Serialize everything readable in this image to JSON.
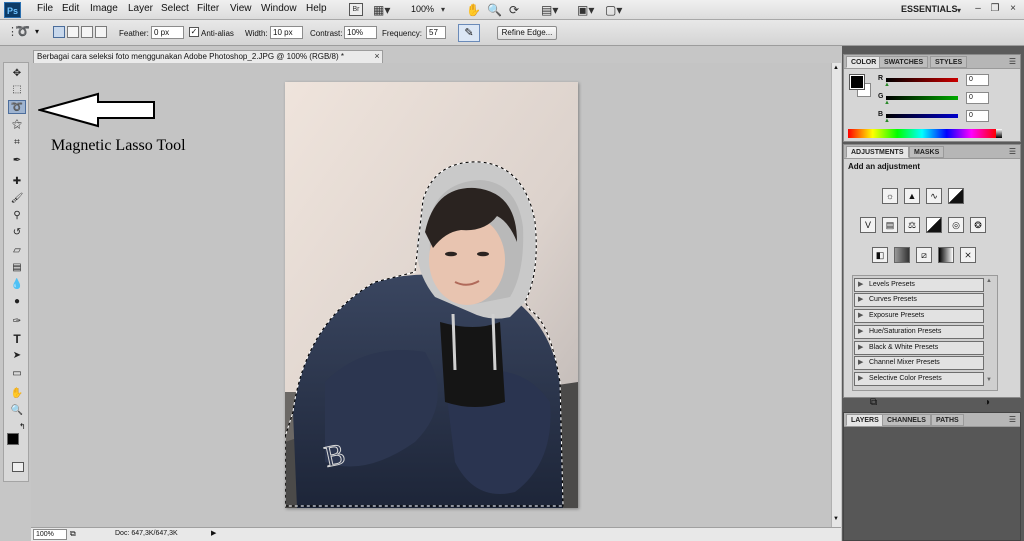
{
  "app": {
    "logo": "Ps",
    "zoom_display": "100%",
    "workspace": "ESSENTIALS"
  },
  "menu": [
    "File",
    "Edit",
    "Image",
    "Layer",
    "Select",
    "Filter",
    "View",
    "Window",
    "Help"
  ],
  "menubar_icons": [
    "bridge-icon",
    "screen-mode-icon",
    "hand-icon",
    "zoom-icon",
    "rotate-icon",
    "arrange-icon",
    "layout-icon",
    "screen-icon"
  ],
  "options": {
    "feather_label": "Feather:",
    "feather_value": "0 px",
    "antialias_label": "Anti-alias",
    "width_label": "Width:",
    "width_value": "10 px",
    "contrast_label": "Contrast:",
    "contrast_value": "10%",
    "frequency_label": "Frequency:",
    "frequency_value": "57",
    "refine_edge": "Refine Edge..."
  },
  "document": {
    "tab_title": "Berbagai cara seleksi foto menggunakan Adobe Photoshop_2.JPG @ 100% (RGB/8) *",
    "close": "×"
  },
  "status": {
    "zoom": "100%",
    "doc_info": "Doc: 647,3K/647,3K"
  },
  "annotation": {
    "text": "Magnetic Lasso Tool"
  },
  "tools": [
    "move-tool",
    "marquee-tool",
    "magnetic-lasso-tool",
    "magic-wand-tool",
    "crop-tool",
    "eyedropper-tool",
    "healing-brush-tool",
    "brush-tool",
    "clone-stamp-tool",
    "history-brush-tool",
    "eraser-tool",
    "gradient-tool",
    "blur-tool",
    "dodge-tool",
    "pen-tool",
    "type-tool",
    "path-selection-tool",
    "shape-tool",
    "hand-tool",
    "zoom-tool"
  ],
  "color_panel": {
    "tabs": [
      "COLOR",
      "SWATCHES",
      "STYLES"
    ],
    "r_label": "R",
    "g_label": "G",
    "b_label": "B",
    "r_value": "0",
    "g_value": "0",
    "b_value": "0",
    "accent_r": "#cc0000",
    "accent_g": "#00aa00",
    "accent_b": "#0000cc"
  },
  "adjustments_panel": {
    "tabs": [
      "ADJUSTMENTS",
      "MASKS"
    ],
    "heading": "Add an adjustment",
    "presets": [
      "Levels Presets",
      "Curves Presets",
      "Exposure Presets",
      "Hue/Saturation Presets",
      "Black & White Presets",
      "Channel Mixer Presets",
      "Selective Color Presets"
    ]
  },
  "layers_panel": {
    "tabs": [
      "LAYERS",
      "CHANNELS",
      "PATHS"
    ]
  }
}
